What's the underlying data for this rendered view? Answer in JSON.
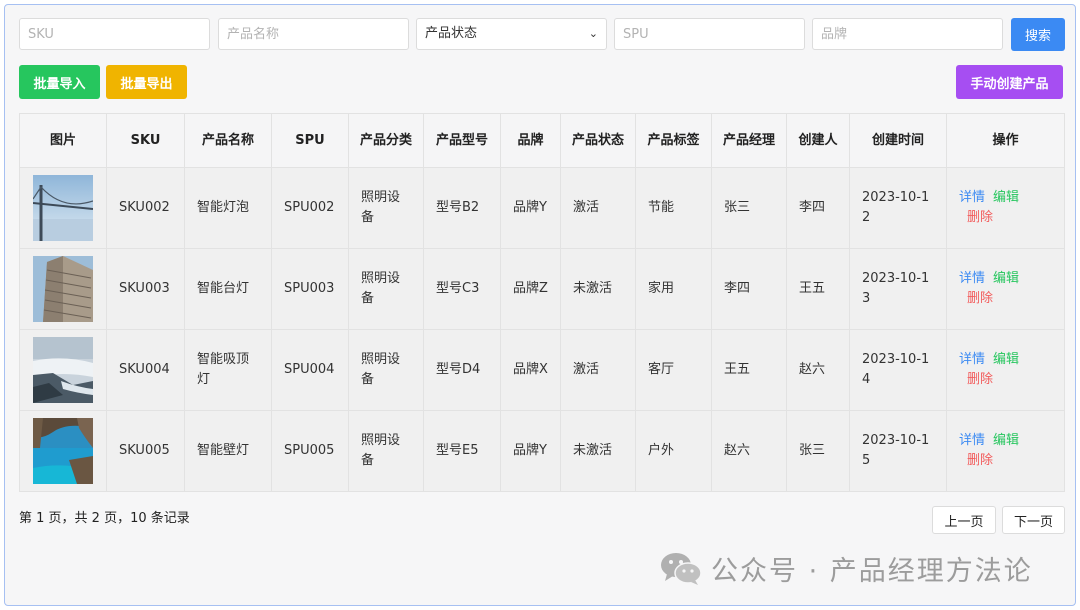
{
  "filters": {
    "sku_placeholder": "SKU",
    "name_placeholder": "产品名称",
    "status_selected": "产品状态",
    "spu_placeholder": "SPU",
    "brand_placeholder": "品牌",
    "search_label": "搜索"
  },
  "toolbar": {
    "import_label": "批量导入",
    "export_label": "批量导出",
    "create_label": "手动创建产品"
  },
  "table": {
    "headers": [
      "图片",
      "SKU",
      "产品名称",
      "SPU",
      "产品分类",
      "产品型号",
      "品牌",
      "产品状态",
      "产品标签",
      "产品经理",
      "创建人",
      "创建时间",
      "操作"
    ],
    "rows": [
      {
        "sku": "SKU002",
        "name": "智能灯泡",
        "spu": "SPU002",
        "category": "照明设备",
        "model": "型号B2",
        "brand": "品牌Y",
        "status": "激活",
        "tag": "节能",
        "manager": "张三",
        "creator": "李四",
        "created": "2023-10-12",
        "thumb": "bridge"
      },
      {
        "sku": "SKU003",
        "name": "智能台灯",
        "spu": "SPU003",
        "category": "照明设备",
        "model": "型号C3",
        "brand": "品牌Z",
        "status": "未激活",
        "tag": "家用",
        "manager": "李四",
        "creator": "王五",
        "created": "2023-10-13",
        "thumb": "building"
      },
      {
        "sku": "SKU004",
        "name": "智能吸顶灯",
        "spu": "SPU004",
        "category": "照明设备",
        "model": "型号D4",
        "brand": "品牌X",
        "status": "激活",
        "tag": "客厅",
        "manager": "王五",
        "creator": "赵六",
        "created": "2023-10-14",
        "thumb": "waterfall"
      },
      {
        "sku": "SKU005",
        "name": "智能壁灯",
        "spu": "SPU005",
        "category": "照明设备",
        "model": "型号E5",
        "brand": "品牌Y",
        "status": "未激活",
        "tag": "户外",
        "manager": "赵六",
        "creator": "张三",
        "created": "2023-10-15",
        "thumb": "sea-cave"
      }
    ],
    "actions": {
      "detail": "详情",
      "edit": "编辑",
      "delete": "删除"
    }
  },
  "pagination": {
    "summary": "第 1 页，共 2 页，10 条记录",
    "prev_label": "上一页",
    "next_label": "下一页"
  },
  "watermark": {
    "text": "公众号 · 产品经理方法论"
  },
  "colors": {
    "search": "#3b8af3",
    "import": "#26c65e",
    "export": "#f0b400",
    "create": "#a64ef2",
    "detail": "#3b8af3",
    "edit": "#26c65e",
    "delete": "#f25c5c"
  }
}
